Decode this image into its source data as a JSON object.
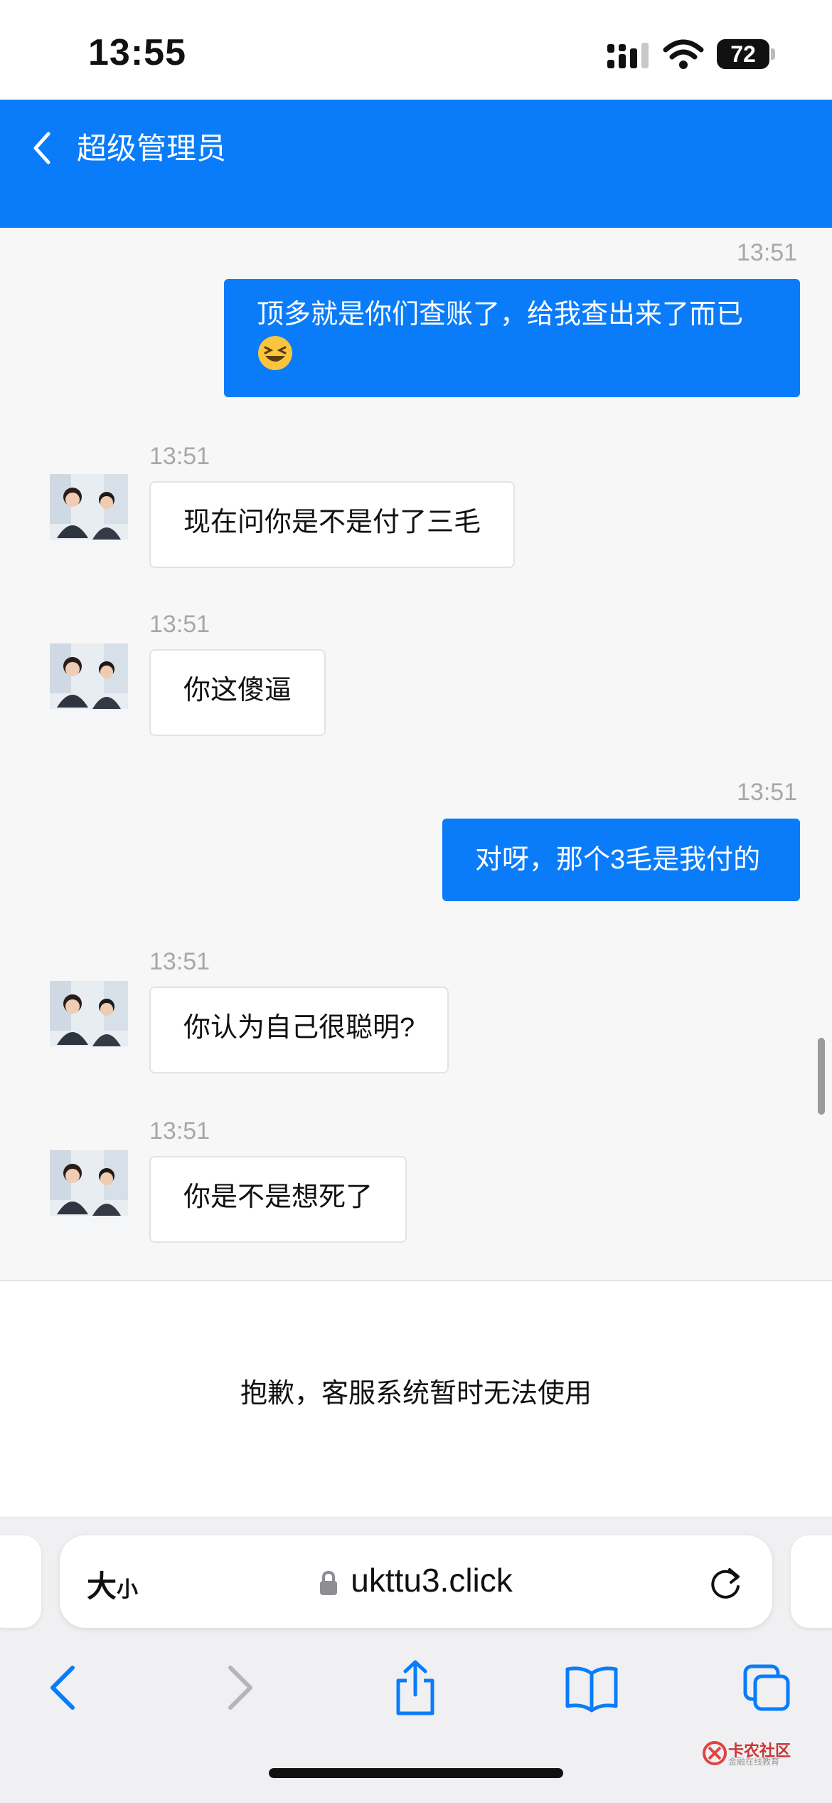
{
  "status_bar": {
    "time": "13:55",
    "battery": "72"
  },
  "header": {
    "title": "超级管理员"
  },
  "messages": [
    {
      "side": "right",
      "time": "13:51",
      "text": "顶多就是你们查账了，给我查出来了而已"
    },
    {
      "side": "left",
      "time": "13:51",
      "text": "现在问你是不是付了三毛"
    },
    {
      "side": "left",
      "time": "13:51",
      "text": "你这傻逼"
    },
    {
      "side": "right",
      "time": "13:51",
      "text": "对呀，那个3毛是我付的"
    },
    {
      "side": "left",
      "time": "13:51",
      "text": "你认为自己很聪明?"
    },
    {
      "side": "left",
      "time": "13:51",
      "text": "你是不是想死了"
    }
  ],
  "notice": {
    "text": "抱歉，客服系统暂时无法使用"
  },
  "safari": {
    "text_size_big": "大",
    "text_size_small": "小",
    "url": "ukttu3.click"
  },
  "watermark": {
    "name": "卡农社区",
    "tagline": "金融在线教育"
  },
  "colors": {
    "accent": "#0a7cfa",
    "background": "#f7f7f8"
  },
  "icons": [
    "back-chevron-icon",
    "signal-icon",
    "wifi-icon",
    "battery-icon",
    "laughing-emoji-icon",
    "agent-avatar",
    "lock-icon",
    "reload-icon",
    "back-icon",
    "forward-icon",
    "share-icon",
    "bookmarks-icon",
    "tabs-icon"
  ]
}
